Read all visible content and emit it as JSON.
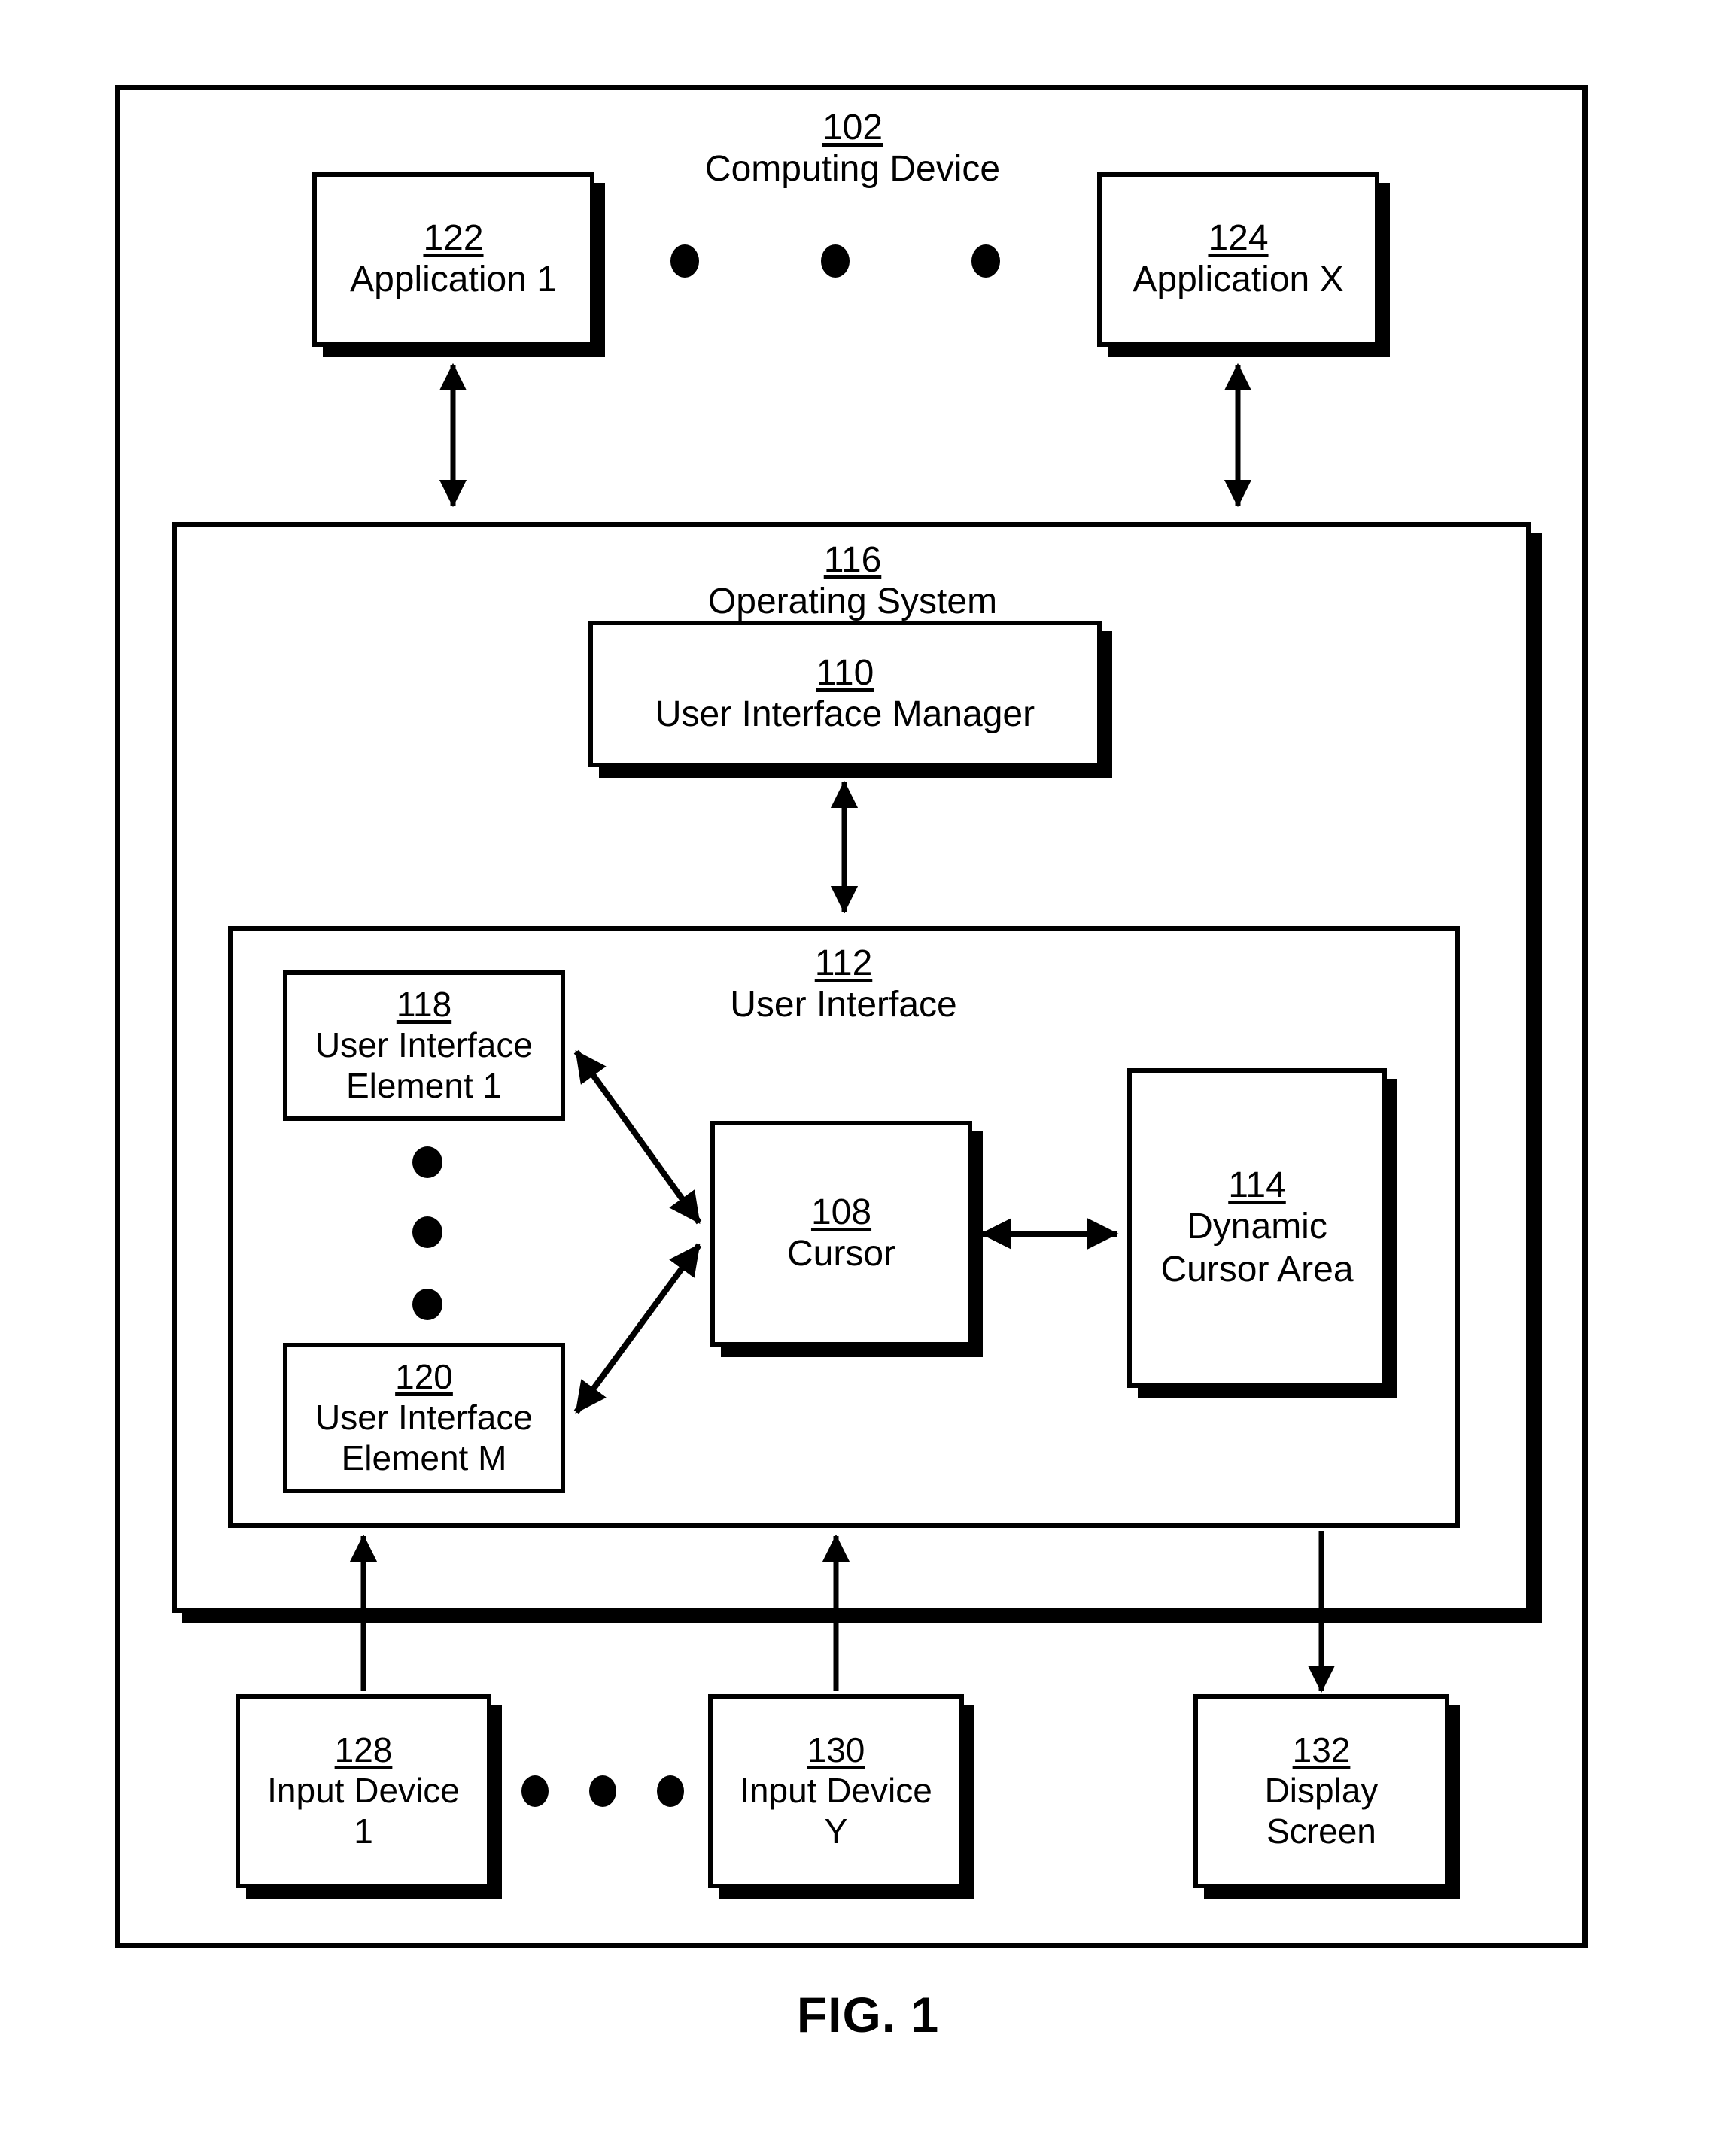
{
  "figure": {
    "caption": "FIG. 1"
  },
  "computing_device": {
    "ref": "102",
    "label": "Computing Device"
  },
  "applications": [
    {
      "ref": "122",
      "label": "Application 1"
    },
    {
      "ref": "124",
      "label": "Application X"
    }
  ],
  "application_ellipsis_dots": 3,
  "operating_system": {
    "ref": "116",
    "label": "Operating System"
  },
  "ui_manager": {
    "ref": "110",
    "label": "User Interface Manager"
  },
  "user_interface": {
    "ref": "112",
    "label": "User Interface"
  },
  "ui_elements": [
    {
      "ref": "118",
      "label": "User Interface\nElement 1"
    },
    {
      "ref": "120",
      "label": "User Interface\nElement M"
    }
  ],
  "ui_element_ellipsis_dots": 3,
  "cursor": {
    "ref": "108",
    "label": "Cursor"
  },
  "dynamic_cursor_area": {
    "ref": "114",
    "label": "Dynamic\nCursor Area"
  },
  "input_devices": [
    {
      "ref": "128",
      "label": "Input Device\n1"
    },
    {
      "ref": "130",
      "label": "Input Device\nY"
    }
  ],
  "input_device_ellipsis_dots": 3,
  "display_screen": {
    "ref": "132",
    "label": "Display\nScreen"
  },
  "colors": {
    "line": "#000000",
    "background": "#ffffff"
  }
}
